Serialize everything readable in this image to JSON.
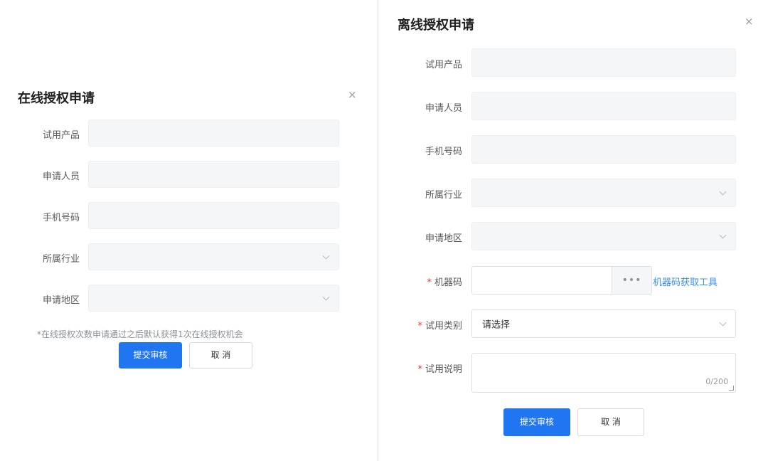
{
  "online_dialog": {
    "title": "在线授权申请",
    "close_icon": "×",
    "fields": [
      {
        "label": "试用产品",
        "type": "text",
        "value": ""
      },
      {
        "label": "申请人员",
        "type": "text",
        "value": ""
      },
      {
        "label": "手机号码",
        "type": "text",
        "value": ""
      },
      {
        "label": "所属行业",
        "type": "select",
        "value": ""
      },
      {
        "label": "申请地区",
        "type": "select",
        "value": ""
      }
    ],
    "note": "*在线授权次数申请通过之后默认获得1次在线授权机会",
    "submit_label": "提交审核",
    "cancel_label": "取 消"
  },
  "offline_dialog": {
    "title": "离线授权申请",
    "close_icon": "×",
    "fields": [
      {
        "label": "试用产品",
        "type": "text",
        "value": ""
      },
      {
        "label": "申请人员",
        "type": "text",
        "value": ""
      },
      {
        "label": "手机号码",
        "type": "text",
        "value": ""
      },
      {
        "label": "所属行业",
        "type": "select",
        "value": ""
      },
      {
        "label": "申请地区",
        "type": "select",
        "value": ""
      }
    ],
    "machine_code": {
      "required_mark": "*",
      "label": "机器码",
      "value": "",
      "more_button": "•••",
      "tool_link": "机器码获取工具"
    },
    "trial_type": {
      "required_mark": "*",
      "label": "试用类别",
      "value": "请选择"
    },
    "trial_description": {
      "required_mark": "*",
      "label": "试用说明",
      "value": "",
      "counter": "0/200"
    },
    "submit_label": "提交审核",
    "cancel_label": "取 消"
  },
  "colors": {
    "primary": "#1f76f0",
    "link": "#3b8ee8",
    "required": "#e5383b",
    "field_bg": "#f5f6f8"
  }
}
